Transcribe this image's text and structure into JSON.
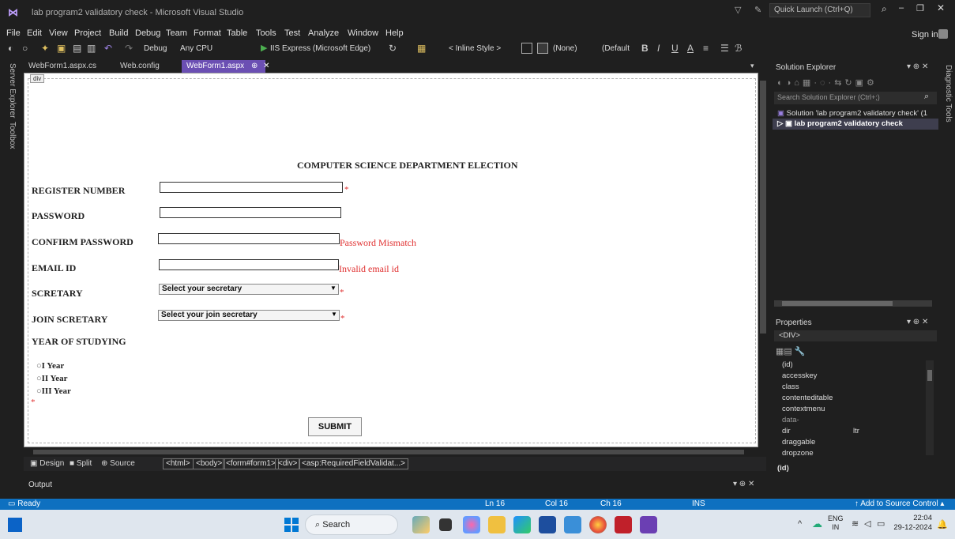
{
  "window": {
    "title": "lab program2 validatory check - Microsoft Visual Studio",
    "quick_launch": "Quick Launch (Ctrl+Q)",
    "sign_in": "Sign in"
  },
  "menu": [
    "File",
    "Edit",
    "View",
    "Project",
    "Build",
    "Debug",
    "Team",
    "Format",
    "Table",
    "Tools",
    "Test",
    "Analyze",
    "Window",
    "Help"
  ],
  "toolbar": {
    "config": "Debug",
    "platform": "Any CPU",
    "run_target": "IIS Express (Microsoft Edge)",
    "inline_style": "< Inline Style >",
    "none": "(None)",
    "default_font": "(Default"
  },
  "side_tabs": [
    "Server Explorer",
    "Toolbox"
  ],
  "right_side_tabs": [
    "Diagnostic Tools"
  ],
  "doc_tabs": [
    {
      "label": "WebForm1.aspx.cs"
    },
    {
      "label": "Web.config"
    },
    {
      "label": "WebForm1.aspx"
    }
  ],
  "design": {
    "div_badge": "div",
    "heading": "COMPUTER SCIENCE DEPARTMENT ELECTION",
    "labels": {
      "register": "REGISTER NUMBER",
      "password": "PASSWORD",
      "confirm": "CONFIRM PASSWORD",
      "email": "EMAIL ID",
      "secretary": "SCRETARY",
      "join": "JOIN SCRETARY",
      "year": "YEAR OF STUDYING"
    },
    "errors": {
      "star": "*",
      "password_mismatch": "Password Mismatch",
      "invalid_email": "Invalid email id"
    },
    "selects": {
      "secretary": "Select your secretary",
      "join": "Select your join secretary"
    },
    "radios": [
      "I Year",
      "II Year",
      "III Year"
    ],
    "submit": "SUBMIT"
  },
  "bottom_tabs": {
    "design": "Design",
    "split": "Split",
    "source": "Source",
    "crumbs": [
      "<html>",
      "<body>",
      "<form#form1>",
      "<div>",
      "<asp:RequiredFieldValidat...>"
    ]
  },
  "output": {
    "label": "Output"
  },
  "solution_explorer": {
    "title": "Solution Explorer",
    "search": "Search Solution Explorer (Ctrl+;)",
    "solution": "Solution 'lab program2 validatory check' (1",
    "project": "lab program2 validatory check"
  },
  "properties": {
    "title": "Properties",
    "object": "<DIV>",
    "rows": [
      {
        "name": "(id)",
        "value": ""
      },
      {
        "name": "accesskey",
        "value": ""
      },
      {
        "name": "class",
        "value": ""
      },
      {
        "name": "contenteditable",
        "value": ""
      },
      {
        "name": "contextmenu",
        "value": ""
      },
      {
        "name": "data-",
        "value": ""
      },
      {
        "name": "dir",
        "value": "ltr"
      },
      {
        "name": "draggable",
        "value": ""
      },
      {
        "name": "dropzone",
        "value": ""
      }
    ],
    "footer": "(id)"
  },
  "status": {
    "ready": "Ready",
    "ln": "Ln 16",
    "col": "Col 16",
    "ch": "Ch 16",
    "ins": "INS",
    "source_control": "Add to Source Control"
  },
  "taskbar": {
    "search": "Search",
    "lang": "ENG",
    "region": "IN",
    "time": "22:04",
    "date": "29-12-2024"
  }
}
